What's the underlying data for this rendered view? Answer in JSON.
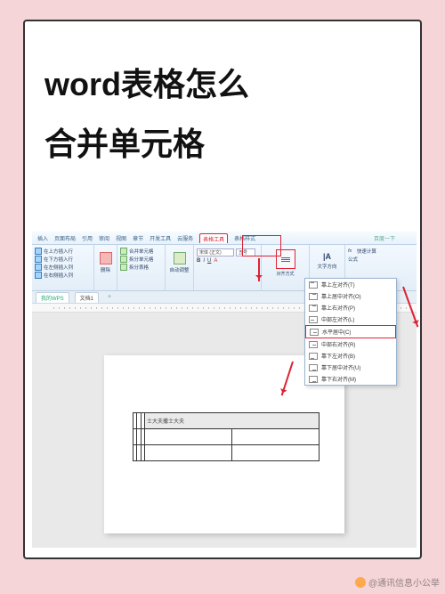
{
  "title_line1": "word表格怎么",
  "title_line2": "合并单元格",
  "ribbon": {
    "tabs": [
      "插入",
      "页面布局",
      "引用",
      "审阅",
      "视图",
      "章节",
      "开发工具",
      "云服务"
    ],
    "active_tab": "表格工具",
    "extra_tab": "表格样式",
    "top_right": "百度一下",
    "groups": {
      "rows_cols": {
        "label": "",
        "items": [
          "在上方插入行",
          "在下方插入行",
          "在左侧插入列",
          "在右侧插入列"
        ]
      },
      "delete": {
        "label": "删除",
        "items": [
          "删除"
        ]
      },
      "merge": {
        "label": "",
        "items": [
          "合并单元格",
          "拆分单元格",
          "拆分表格"
        ]
      },
      "adjust": {
        "label": "",
        "items": [
          "自动调整"
        ]
      },
      "font": {
        "name": "宋体 (正文)",
        "size": "五号",
        "bold": "B",
        "italic": "I",
        "underline": "U",
        "color": "A"
      },
      "align": {
        "button": "对齐方式",
        "text_dir": "文字方向",
        "fx": "fx",
        "fast": "快速计算",
        "formula": "公式"
      }
    }
  },
  "alignment_menu": [
    {
      "al": "tlt",
      "label": "靠上左对齐(T)"
    },
    {
      "al": "tct",
      "label": "靠上居中对齐(O)"
    },
    {
      "al": "trt",
      "label": "靠上右对齐(P)"
    },
    {
      "al": "mlt",
      "label": "中部左对齐(L)"
    },
    {
      "al": "mct",
      "label": "水平居中(C)",
      "highlight": true
    },
    {
      "al": "mrt",
      "label": "中部右对齐(R)"
    },
    {
      "al": "blt",
      "label": "靠下左对齐(B)"
    },
    {
      "al": "bct",
      "label": "靠下居中对齐(U)"
    },
    {
      "al": "brt",
      "label": "靠下右对齐(M)"
    }
  ],
  "doc_tabs": {
    "home": "我的WPS",
    "doc": "文档1"
  },
  "table_merged_text": "士大夫撒士大夫",
  "watermark": "@通讯信息小公举"
}
